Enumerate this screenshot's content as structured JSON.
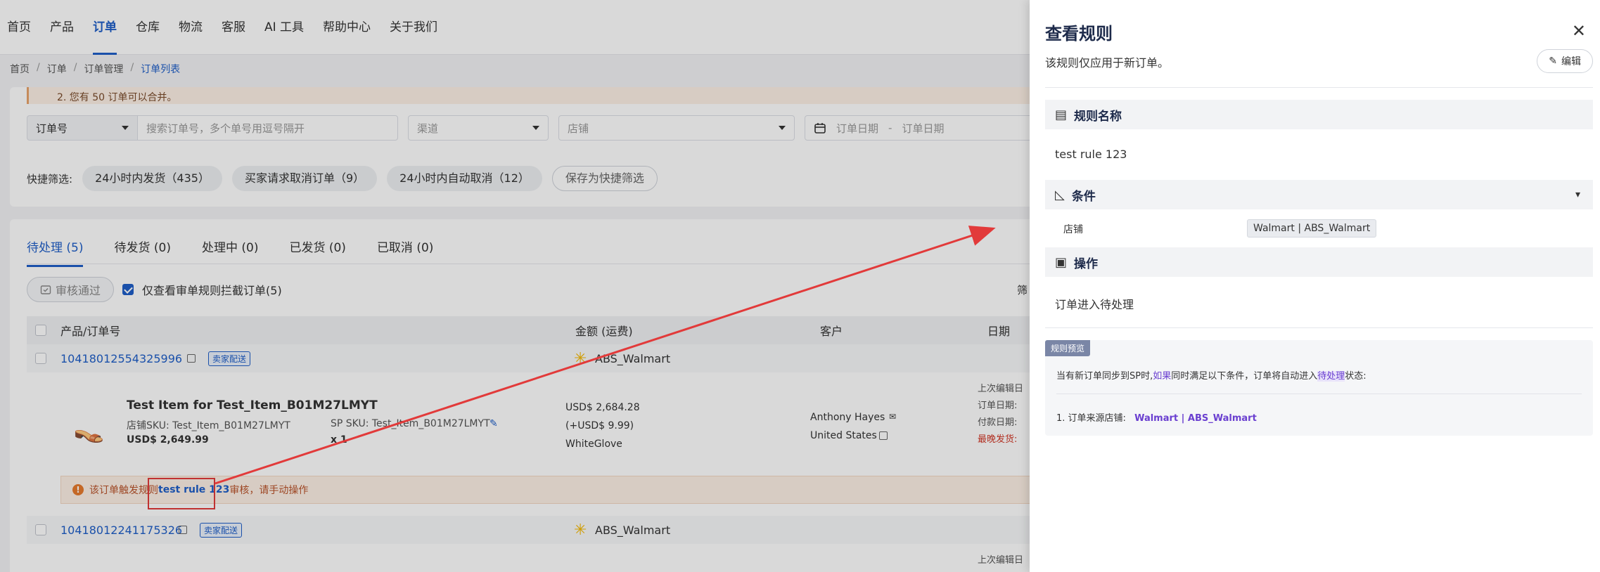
{
  "nav": {
    "items": [
      "首页",
      "产品",
      "订单",
      "仓库",
      "物流",
      "客服",
      "AI 工具",
      "帮助中心",
      "关于我们"
    ],
    "active_index": 2
  },
  "breadcrumb": [
    "首页",
    "订单",
    "订单管理",
    "订单列表"
  ],
  "notice_text": "2. 您有 50 订单可以合并。",
  "filters": {
    "order_type": "订单号",
    "search_placeholder": "搜索订单号，多个单号用逗号隔开",
    "channel_placeholder": "渠道",
    "store_placeholder": "店铺",
    "date_start": "订单日期",
    "date_sep": "-",
    "date_end": "订单日期"
  },
  "quick_filter": {
    "label": "快捷筛选:",
    "chips": [
      "24小时内发货（435）",
      "买家请求取消订单（9）",
      "24小时内自动取消（12）"
    ],
    "save": "保存为快捷筛选"
  },
  "tabs": [
    "待处理 (5)",
    "待发货 (0)",
    "处理中 (0)",
    "已发货 (0)",
    "已取消 (0)"
  ],
  "actions": {
    "approve": "审核通过",
    "only_rule_label": "仅查看审单规则拦截订单(5)",
    "filter_cut": "筛"
  },
  "table": {
    "headers": [
      "产品/订单号",
      "金额 (运费)",
      "客户",
      "日期"
    ],
    "orders": [
      {
        "order_no": "10418012554325996",
        "tag": "卖家配送",
        "store": "ABS_Walmart",
        "item_title": "Test Item for Test_Item_B01M27LMYT",
        "store_sku": "店铺SKU: Test_Item_B01M27LMYT",
        "sp_sku": "SP SKU: Test_Item_B01M27LMYT",
        "price": "USD$ 2,649.99",
        "qty": "x 1",
        "amount": "USD$ 2,684.28",
        "shipping": "(+USD$ 9.99)",
        "carrier": "WhiteGlove",
        "customer": "Anthony Hayes",
        "country": "United States",
        "dates": [
          "上次编辑日",
          "订单日期:",
          "付款日期:",
          "最晚发货:"
        ]
      },
      {
        "order_no": "10418012241175326",
        "tag": "卖家配送",
        "store": "ABS_Walmart",
        "dates": [
          "上次编辑日"
        ]
      }
    ],
    "warning": {
      "prefix": "该订单触发规则",
      "rule": "test rule 123",
      "suffix": "审核，请手动操作"
    }
  },
  "drawer": {
    "title": "查看规则",
    "subtitle": "该规则仅应用于新订单。",
    "edit": "编辑",
    "rule_name_heading": "规则名称",
    "rule_name": "test rule 123",
    "conditions_heading": "条件",
    "condition_label": "店铺",
    "condition_value": "Walmart | ABS_Walmart",
    "actions_heading": "操作",
    "action_value": "订单进入待处理",
    "preview": {
      "badge": "规则预览",
      "line1_a": "当有新订单同步到SP时,",
      "line1_b": "如果",
      "line1_c": "同时满足以下条件，订单将自动进入",
      "line1_d": "待处理",
      "line1_e": "状态:",
      "line2_a": "1. 订单来源店铺:",
      "line2_b": "Walmart | ABS_Walmart"
    }
  },
  "colors": {
    "accent": "#1f5fc8",
    "warning": "#b9532a",
    "arrow": "#e23a3a",
    "highlight": "#6a3fd0"
  }
}
